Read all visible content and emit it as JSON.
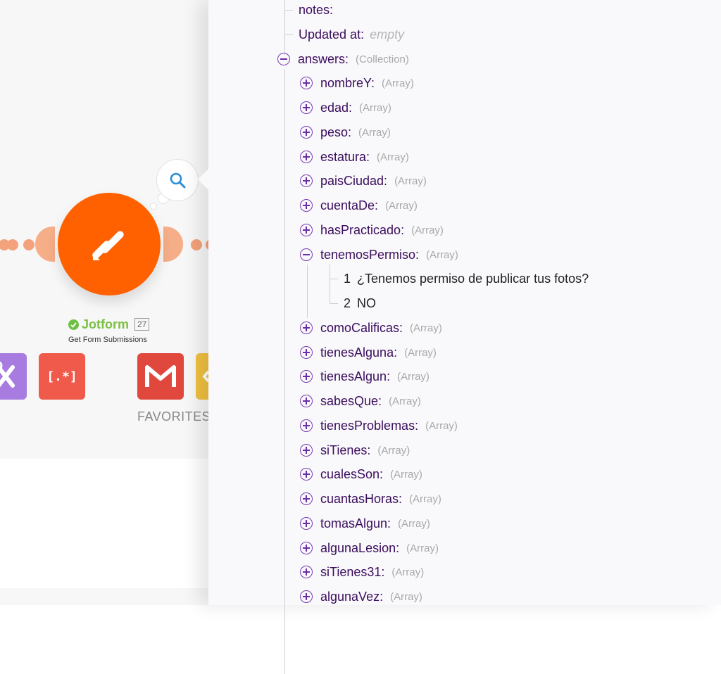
{
  "module": {
    "name": "Jotform",
    "count": "27",
    "subtitle": "Get Form Submissions",
    "color": "#ff6100"
  },
  "favorites": {
    "label": "FAVORITES",
    "regex_tile_text": "[.*]"
  },
  "inspector": {
    "top_fields": [
      {
        "key": "notes:"
      },
      {
        "key": "Updated at:",
        "value": "empty"
      }
    ],
    "collection": {
      "key": "answers:",
      "type": "(Collection)",
      "state": "expanded"
    },
    "answers_before": [
      {
        "key": "nombreY:",
        "type": "(Array)"
      },
      {
        "key": "edad:",
        "type": "(Array)"
      },
      {
        "key": "peso:",
        "type": "(Array)"
      },
      {
        "key": "estatura:",
        "type": "(Array)"
      },
      {
        "key": "paisCiudad:",
        "type": "(Array)"
      },
      {
        "key": "cuentaDe:",
        "type": "(Array)"
      },
      {
        "key": "hasPracticado:",
        "type": "(Array)"
      }
    ],
    "expanded_item": {
      "key": "tenemosPermiso:",
      "type": "(Array)",
      "items": [
        {
          "index": "1",
          "value": "¿Tenemos permiso de publicar tus fotos?"
        },
        {
          "index": "2",
          "value": "NO"
        }
      ]
    },
    "answers_after": [
      {
        "key": "comoCalificas:",
        "type": "(Array)"
      },
      {
        "key": "tienesAlguna:",
        "type": "(Array)"
      },
      {
        "key": "tienesAlgun:",
        "type": "(Array)"
      },
      {
        "key": "sabesQue:",
        "type": "(Array)"
      },
      {
        "key": "tienesProblemas:",
        "type": "(Array)"
      },
      {
        "key": "siTienes:",
        "type": "(Array)"
      },
      {
        "key": "cualesSon:",
        "type": "(Array)"
      },
      {
        "key": "cuantasHoras:",
        "type": "(Array)"
      },
      {
        "key": "tomasAlgun:",
        "type": "(Array)"
      },
      {
        "key": "algunaLesion:",
        "type": "(Array)"
      },
      {
        "key": "siTienes31:",
        "type": "(Array)"
      },
      {
        "key": "algunaVez:",
        "type": "(Array)"
      }
    ]
  }
}
